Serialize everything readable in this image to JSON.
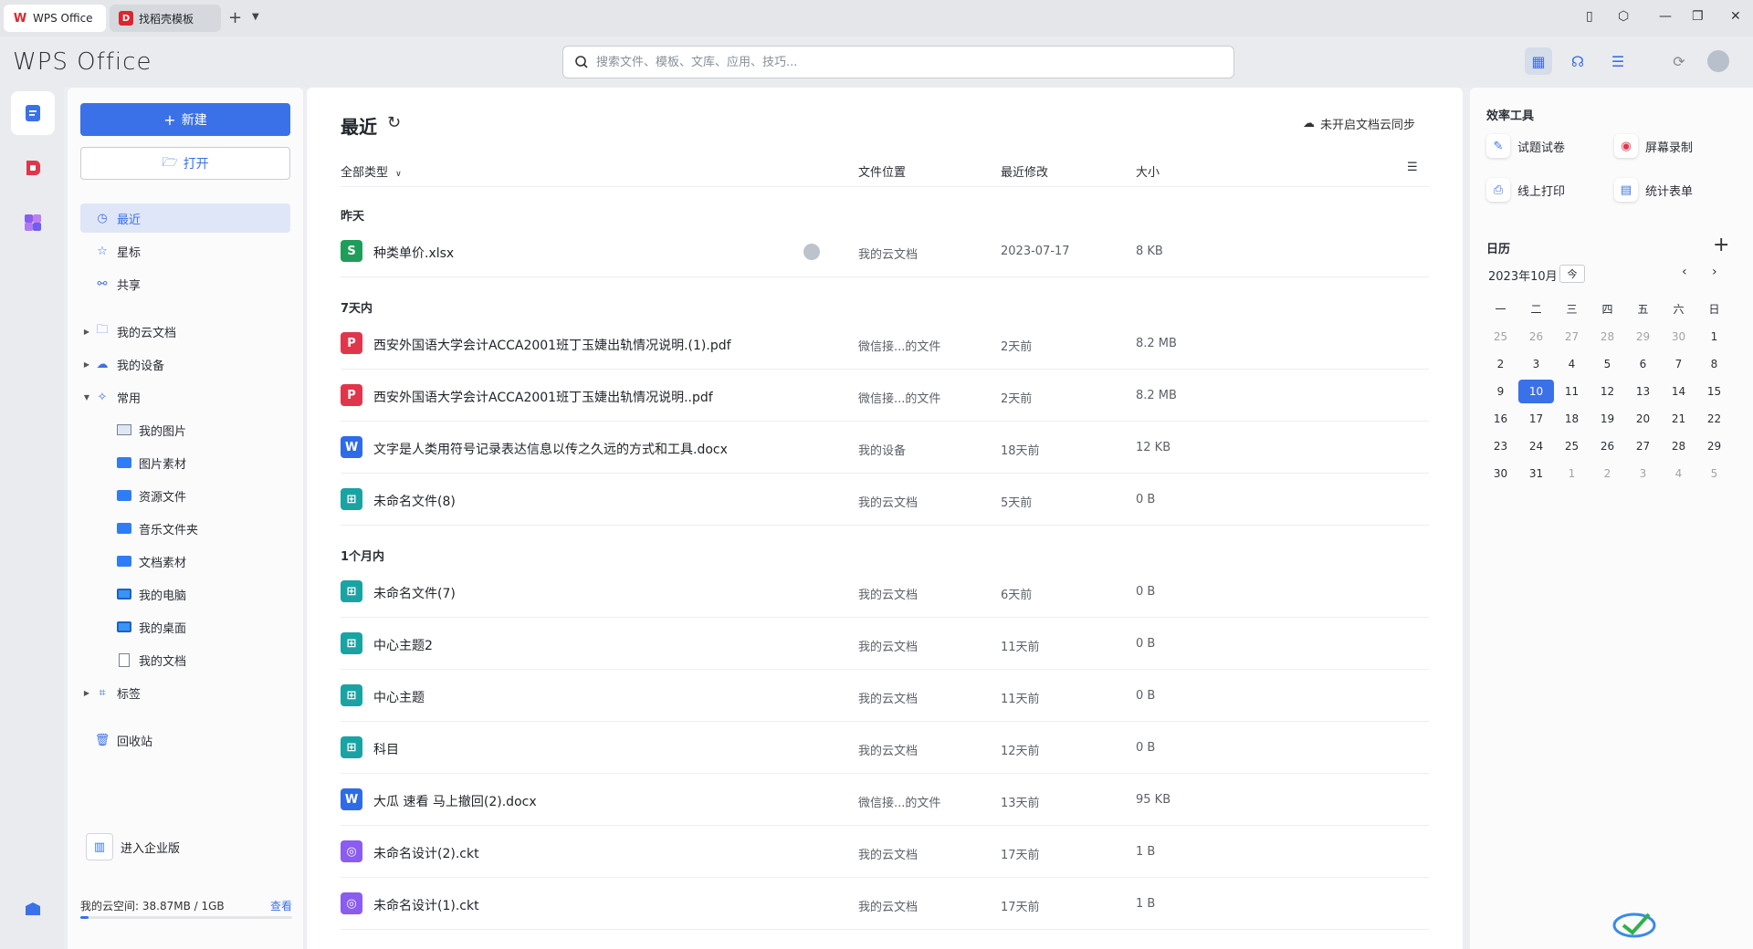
{
  "tabs": [
    {
      "label": "WPS Office"
    },
    {
      "label": "找稻壳模板"
    }
  ],
  "header": {
    "logo": "WPS Office",
    "search_placeholder": "搜索文件、模板、文库、应用、技巧..."
  },
  "sidebar": {
    "new_label": "新建",
    "open_label": "打开",
    "nav": [
      {
        "label": "最近",
        "icon": "clock-icon",
        "active": true
      },
      {
        "label": "星标",
        "icon": "star-icon"
      },
      {
        "label": "共享",
        "icon": "share-icon"
      },
      {
        "label": "我的云文档",
        "icon": "folder-icon"
      },
      {
        "label": "我的设备",
        "icon": "device-icon"
      },
      {
        "label": "常用",
        "icon": "pin-icon"
      },
      {
        "label": "我的图片",
        "icon": "image-folder-icon"
      },
      {
        "label": "图片素材",
        "icon": "folder-icon"
      },
      {
        "label": "资源文件",
        "icon": "folder-icon"
      },
      {
        "label": "音乐文件夹",
        "icon": "folder-icon"
      },
      {
        "label": "文档素材",
        "icon": "folder-icon"
      },
      {
        "label": "我的电脑",
        "icon": "computer-icon"
      },
      {
        "label": "我的桌面",
        "icon": "desktop-icon"
      },
      {
        "label": "我的文档",
        "icon": "document-icon"
      },
      {
        "label": "标签",
        "icon": "tag-icon"
      },
      {
        "label": "回收站",
        "icon": "trash-icon"
      }
    ],
    "enterprise_label": "进入企业版",
    "storage_label": "我的云空间: 38.87MB / 1GB",
    "storage_view": "查看",
    "storage_fraction": 0.038
  },
  "main": {
    "title": "最近",
    "sync_label": "未开启文档云同步",
    "columns": {
      "type": "全部类型",
      "location": "文件位置",
      "modified": "最近修改",
      "size": "大小"
    },
    "groups": [
      {
        "label": "昨天"
      },
      {
        "label": "7天内"
      },
      {
        "label": "1个月内"
      }
    ],
    "files": [
      {
        "name": "种类单价.xlsx",
        "location": "我的云文档",
        "modified": "2023-07-17",
        "size": "8 KB",
        "type": "sheet",
        "icon_char": "S",
        "color": "#1e9e5a"
      },
      {
        "name": "西安外国语大学会计ACCA2001班丁玉婕出轨情况说明.(1).pdf",
        "location": "微信接...的文件",
        "modified": "2天前",
        "size": "8.2 MB",
        "type": "pdf",
        "icon_char": "P",
        "color": "#e0364b"
      },
      {
        "name": "西安外国语大学会计ACCA2001班丁玉婕出轨情况说明..pdf",
        "location": "微信接...的文件",
        "modified": "2天前",
        "size": "8.2 MB",
        "type": "pdf",
        "icon_char": "P",
        "color": "#e0364b"
      },
      {
        "name": "文字是人类用符号记录表达信息以传之久远的方式和工具.docx",
        "location": "我的设备",
        "modified": "18天前",
        "size": "12 KB",
        "type": "doc",
        "icon_char": "W",
        "color": "#2f6ae8"
      },
      {
        "name": "未命名文件(8)",
        "location": "我的云文档",
        "modified": "5天前",
        "size": "0 B",
        "type": "mindmap",
        "icon_char": "⊞",
        "color": "#1aa3a3"
      },
      {
        "name": "未命名文件(7)",
        "location": "我的云文档",
        "modified": "6天前",
        "size": "0 B",
        "type": "mindmap",
        "icon_char": "⊞",
        "color": "#1aa3a3"
      },
      {
        "name": "中心主题2",
        "location": "我的云文档",
        "modified": "11天前",
        "size": "0 B",
        "type": "mindmap",
        "icon_char": "⊞",
        "color": "#1aa3a3"
      },
      {
        "name": "中心主题",
        "location": "我的云文档",
        "modified": "11天前",
        "size": "0 B",
        "type": "mindmap",
        "icon_char": "⊞",
        "color": "#1aa3a3"
      },
      {
        "name": "科目",
        "location": "我的云文档",
        "modified": "12天前",
        "size": "0 B",
        "type": "mindmap",
        "icon_char": "⊞",
        "color": "#1aa3a3"
      },
      {
        "name": "大瓜 速看 马上撤回(2).docx",
        "location": "微信接...的文件",
        "modified": "13天前",
        "size": "95 KB",
        "type": "doc",
        "icon_char": "W",
        "color": "#2f6ae8"
      },
      {
        "name": "未命名设计(2).ckt",
        "location": "我的云文档",
        "modified": "17天前",
        "size": "1 B",
        "type": "design",
        "icon_char": "◎",
        "color": "#8a5cf0"
      },
      {
        "name": "未命名设计(1).ckt",
        "location": "我的云文档",
        "modified": "17天前",
        "size": "1 B",
        "type": "design",
        "icon_char": "◎",
        "color": "#8a5cf0"
      }
    ]
  },
  "right": {
    "tools_title": "效率工具",
    "tools": [
      {
        "label": "试题试卷",
        "icon": "exam-icon",
        "color": "#3b71e8",
        "glyph": "✎"
      },
      {
        "label": "屏幕录制",
        "icon": "record-icon",
        "color": "#e0364b",
        "glyph": "◉"
      },
      {
        "label": "线上打印",
        "icon": "print-icon",
        "color": "#3b71e8",
        "glyph": "⎙"
      },
      {
        "label": "统计表单",
        "icon": "form-icon",
        "color": "#3b71e8",
        "glyph": "▤"
      }
    ],
    "calendar_title": "日历",
    "month": "2023年10月",
    "today_label": "今",
    "weekdays": [
      "一",
      "二",
      "三",
      "四",
      "五",
      "六",
      "日"
    ],
    "weeks": [
      [
        "25",
        "26",
        "27",
        "28",
        "29",
        "30",
        "1"
      ],
      [
        "2",
        "3",
        "4",
        "5",
        "6",
        "7",
        "8"
      ],
      [
        "9",
        "10",
        "11",
        "12",
        "13",
        "14",
        "15"
      ],
      [
        "16",
        "17",
        "18",
        "19",
        "20",
        "21",
        "22"
      ],
      [
        "23",
        "24",
        "25",
        "26",
        "27",
        "28",
        "29"
      ],
      [
        "30",
        "31",
        "1",
        "2",
        "3",
        "4",
        "5"
      ]
    ],
    "selected_day": "10"
  }
}
